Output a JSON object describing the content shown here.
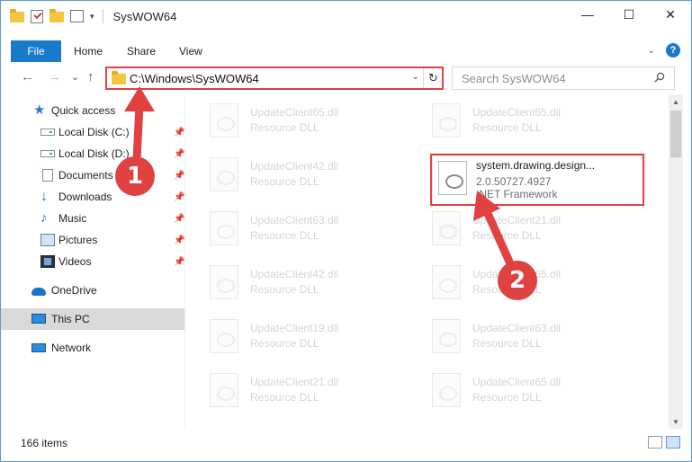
{
  "window": {
    "title": "SysWOW64",
    "controls": {
      "minimize": "—",
      "maximize": "☐",
      "close": "✕"
    }
  },
  "ribbon": {
    "tabs": [
      "File",
      "Home",
      "Share",
      "View"
    ],
    "expand_icon": "chevron-down-icon",
    "help_label": "?"
  },
  "nav": {
    "back": "←",
    "forward": "→",
    "recent": "⌄",
    "up": "↑",
    "address": "C:\\Windows\\SysWOW64",
    "refresh": "↻",
    "search_placeholder": "Search SysWOW64"
  },
  "sidebar": {
    "items": [
      {
        "label": "Quick access",
        "icon": "star-icon",
        "pinned": false
      },
      {
        "label": "Local Disk (C:)",
        "icon": "disk-icon",
        "pinned": true
      },
      {
        "label": "Local Disk (D:)",
        "icon": "disk-icon",
        "pinned": true
      },
      {
        "label": "Documents",
        "icon": "documents-icon",
        "pinned": true
      },
      {
        "label": "Downloads",
        "icon": "downloads-icon",
        "pinned": true
      },
      {
        "label": "Music",
        "icon": "music-icon",
        "pinned": true
      },
      {
        "label": "Pictures",
        "icon": "pictures-icon",
        "pinned": true
      },
      {
        "label": "Videos",
        "icon": "videos-icon",
        "pinned": true
      },
      {
        "label": "OneDrive",
        "icon": "onedrive-icon",
        "pinned": false
      },
      {
        "label": "This PC",
        "icon": "this-pc-icon",
        "pinned": false,
        "selected": true
      },
      {
        "label": "Network",
        "icon": "network-icon",
        "pinned": false
      }
    ]
  },
  "files": {
    "left_column": [
      {
        "name": "UpdateClient65.dll",
        "type": "Resource DLL"
      },
      {
        "name": "UpdateClient42.dll",
        "type": "Resource DLL"
      },
      {
        "name": "UpdateClient63.dll",
        "type": "Resource DLL"
      },
      {
        "name": "UpdateClient42.dll",
        "type": "Resource DLL"
      },
      {
        "name": "UpdateClient19.dll",
        "type": "Resource DLL"
      },
      {
        "name": "UpdateClient21.dll",
        "type": "Resource DLL"
      }
    ],
    "right_column": [
      {
        "name": "UpdateClient65.dll",
        "type": "Resource DLL"
      },
      {
        "name": "UpdateClient21.dll",
        "type": "Resource DLL"
      },
      {
        "name": "UpdateClient65.dll",
        "type": "Resource DLL"
      },
      {
        "name": "UpdateClient63.dll",
        "type": "Resource DLL"
      },
      {
        "name": "UpdateClient65.dll",
        "type": "Resource DLL"
      }
    ],
    "featured": {
      "name": "system.drawing.design...",
      "version": "2.0.50727.4927",
      "description": ".NET Framework"
    }
  },
  "status": {
    "item_count": "166 items"
  },
  "annotations": {
    "step1": "1",
    "step2": "2",
    "color": "#e04141"
  }
}
